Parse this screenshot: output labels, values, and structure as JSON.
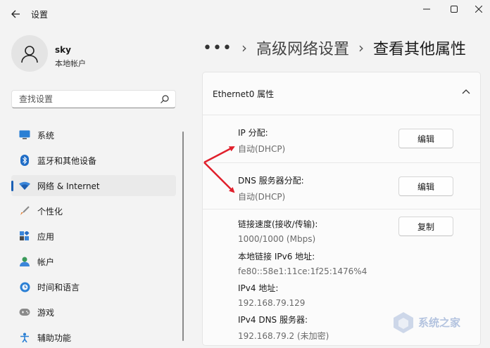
{
  "window": {
    "title": "设置",
    "controls": [
      "minimize",
      "maximize",
      "close"
    ]
  },
  "profile": {
    "name": "sky",
    "account_type": "本地帐户",
    "avatar_icon": "person-icon"
  },
  "search": {
    "placeholder": "查找设置",
    "icon": "search-icon"
  },
  "sidebar": {
    "items": [
      {
        "label": "系统",
        "icon": "monitor-icon",
        "active": false
      },
      {
        "label": "蓝牙和其他设备",
        "icon": "bluetooth-icon",
        "active": false
      },
      {
        "label": "网络 & Internet",
        "icon": "wifi-icon",
        "active": true
      },
      {
        "label": "个性化",
        "icon": "brush-icon",
        "active": false
      },
      {
        "label": "应用",
        "icon": "apps-icon",
        "active": false
      },
      {
        "label": "帐户",
        "icon": "account-icon",
        "active": false
      },
      {
        "label": "时间和语言",
        "icon": "globe-clock-icon",
        "active": false
      },
      {
        "label": "游戏",
        "icon": "gamepad-icon",
        "active": false
      },
      {
        "label": "辅助功能",
        "icon": "accessibility-icon",
        "active": false
      }
    ]
  },
  "breadcrumb": {
    "more": "•••",
    "parent": "高级网络设置",
    "current": "查看其他属性"
  },
  "card": {
    "title": "Ethernet0 属性",
    "ip_assignment": {
      "label": "IP 分配:",
      "value": "自动(DHCP)",
      "button": "编辑"
    },
    "dns_assignment": {
      "label": "DNS 服务器分配:",
      "value": "自动(DHCP)",
      "button": "编辑"
    },
    "copy_button": "复制",
    "properties": [
      {
        "label": "链接速度(接收/传输):",
        "value": "1000/1000 (Mbps)"
      },
      {
        "label": "本地链接 IPv6 地址:",
        "value": "fe80::58e1:11ce:1f25:1476%4"
      },
      {
        "label": "IPv4 地址:",
        "value": "192.168.79.129"
      },
      {
        "label": "IPv4 DNS 服务器:",
        "value": "192.168.79.2 (未加密)"
      }
    ]
  },
  "annotation": {
    "color": "#e0202c"
  },
  "watermark": {
    "text": "系统之家"
  },
  "colors": {
    "accent": "#1a5fb4",
    "background": "#f3f3f3",
    "card": "#fbfbfb"
  }
}
